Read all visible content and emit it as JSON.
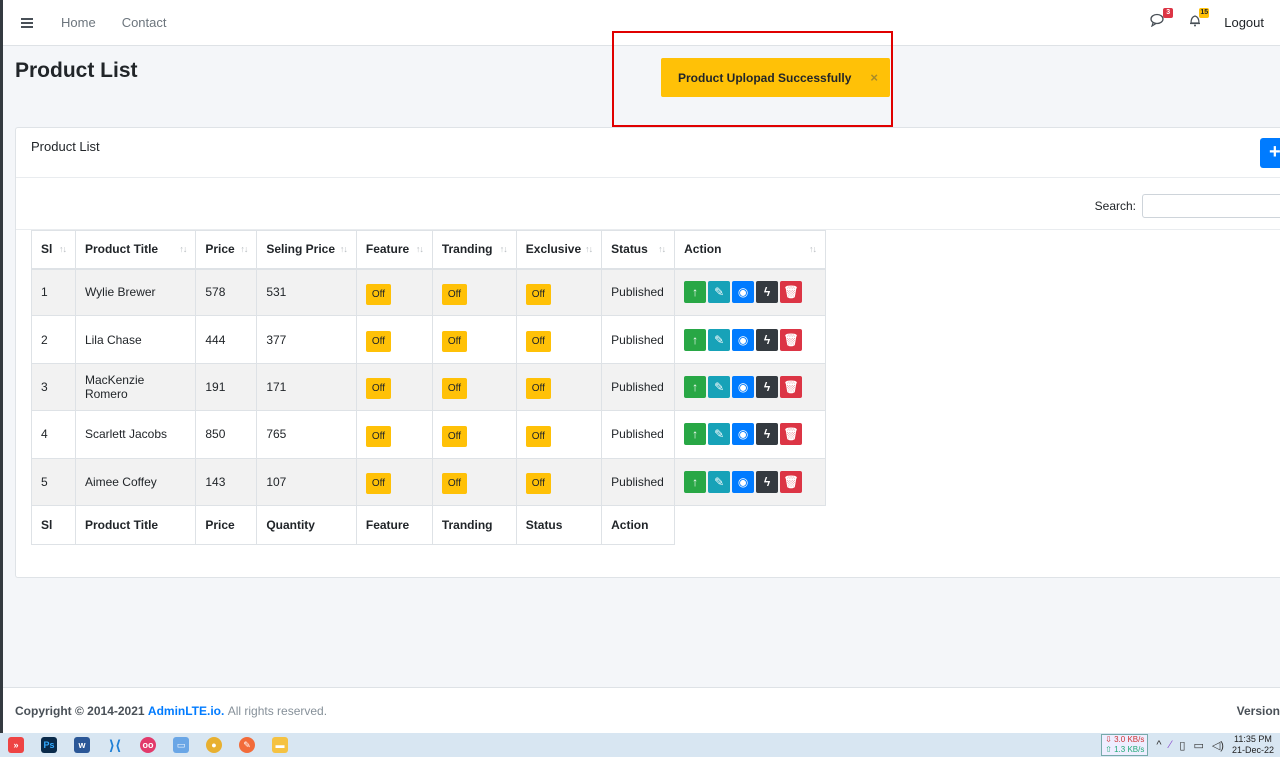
{
  "navbar": {
    "links": [
      "Home",
      "Contact"
    ],
    "messages_count": "3",
    "notifications_count": "15",
    "logout_label": "Logout"
  },
  "page_title": "Product List",
  "toast": {
    "message": "Product Uplopad Successfully",
    "close": "×"
  },
  "card": {
    "title": "Product List",
    "add_button": "+",
    "search_label": "Search:"
  },
  "table": {
    "headers": [
      "Sl",
      "Product Title",
      "Price",
      "Seling Price",
      "Feature",
      "Tranding",
      "Exclusive",
      "Status",
      "Action"
    ],
    "footers": [
      "Sl",
      "Product Title",
      "Price",
      "Quantity",
      "Feature",
      "Tranding",
      "Status",
      "Action"
    ],
    "rows": [
      {
        "sl": "1",
        "title": "Wylie Brewer",
        "price": "578",
        "selling": "531",
        "feature": "Off",
        "tranding": "Off",
        "exclusive": "Off",
        "status": "Published"
      },
      {
        "sl": "2",
        "title": "Lila Chase",
        "price": "444",
        "selling": "377",
        "feature": "Off",
        "tranding": "Off",
        "exclusive": "Off",
        "status": "Published"
      },
      {
        "sl": "3",
        "title": "MacKenzie Romero",
        "price": "191",
        "selling": "171",
        "feature": "Off",
        "tranding": "Off",
        "exclusive": "Off",
        "status": "Published"
      },
      {
        "sl": "4",
        "title": "Scarlett Jacobs",
        "price": "850",
        "selling": "765",
        "feature": "Off",
        "tranding": "Off",
        "exclusive": "Off",
        "status": "Published"
      },
      {
        "sl": "5",
        "title": "Aimee Coffey",
        "price": "143",
        "selling": "107",
        "feature": "Off",
        "tranding": "Off",
        "exclusive": "Off",
        "status": "Published"
      }
    ]
  },
  "footer": {
    "copyright": "Copyright © 2014-2021",
    "brand": "AdminLTE.io.",
    "rights": "All rights reserved.",
    "version": "Version"
  },
  "taskbar": {
    "net_down": "3.0 KB/s",
    "net_up": "1.3 KB/s",
    "time": "11:35 PM",
    "date": "21-Dec-22"
  },
  "colors": {
    "primary": "#007bff",
    "warning": "#ffc107",
    "success": "#28a745",
    "info": "#17a2b8",
    "dark": "#343a40",
    "danger": "#dc3545",
    "highlight": "#e00000"
  }
}
